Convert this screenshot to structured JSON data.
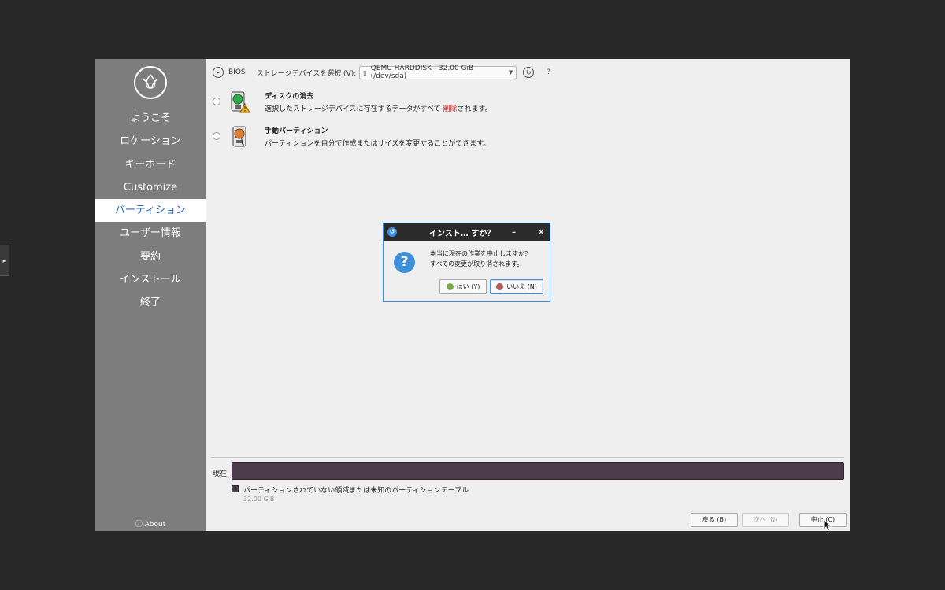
{
  "sidebar": {
    "items": [
      {
        "label": "ようこそ"
      },
      {
        "label": "ロケーション"
      },
      {
        "label": "キーボード"
      },
      {
        "label": "Customize"
      },
      {
        "label": "パーティション"
      },
      {
        "label": "ユーザー情報"
      },
      {
        "label": "要約"
      },
      {
        "label": "インストール"
      },
      {
        "label": "終了"
      }
    ],
    "active_index": 4,
    "about": "ⓘ About"
  },
  "toolbar": {
    "bios": "BIOS",
    "select_label": "ストレージデバイスを選択 (V):",
    "device": "QEMU HARDDISK - 32.00 GiB (/dev/sda)",
    "help": "?"
  },
  "options": {
    "erase_title": "ディスクの消去",
    "erase_desc_pre": "選択したストレージデバイスに存在するデータがすべて ",
    "erase_desc_red": "削除",
    "erase_desc_post": "されます。",
    "manual_title": "手動パーティション",
    "manual_desc": "パーティションを自分で作成またはサイズを変更することができます。"
  },
  "current": {
    "label": "現在:",
    "legend": "パーティションされていない領域または未知のパーティションテーブル",
    "size": "32.00 GiB",
    "bar_color": "#4b3b4b"
  },
  "nav_buttons": {
    "back": "戻る (B)",
    "next": "次へ (N)",
    "cancel": "中止 (C)"
  },
  "dialog": {
    "title": "インスト… すか？",
    "min": "–",
    "close": "×",
    "message_line1": "本当に現在の作業を中止しますか？",
    "message_line2": "すべての変更が取り消されます。",
    "yes": "はい (Y)",
    "no": "いいえ (N)",
    "accent": "#3d8ee0"
  }
}
